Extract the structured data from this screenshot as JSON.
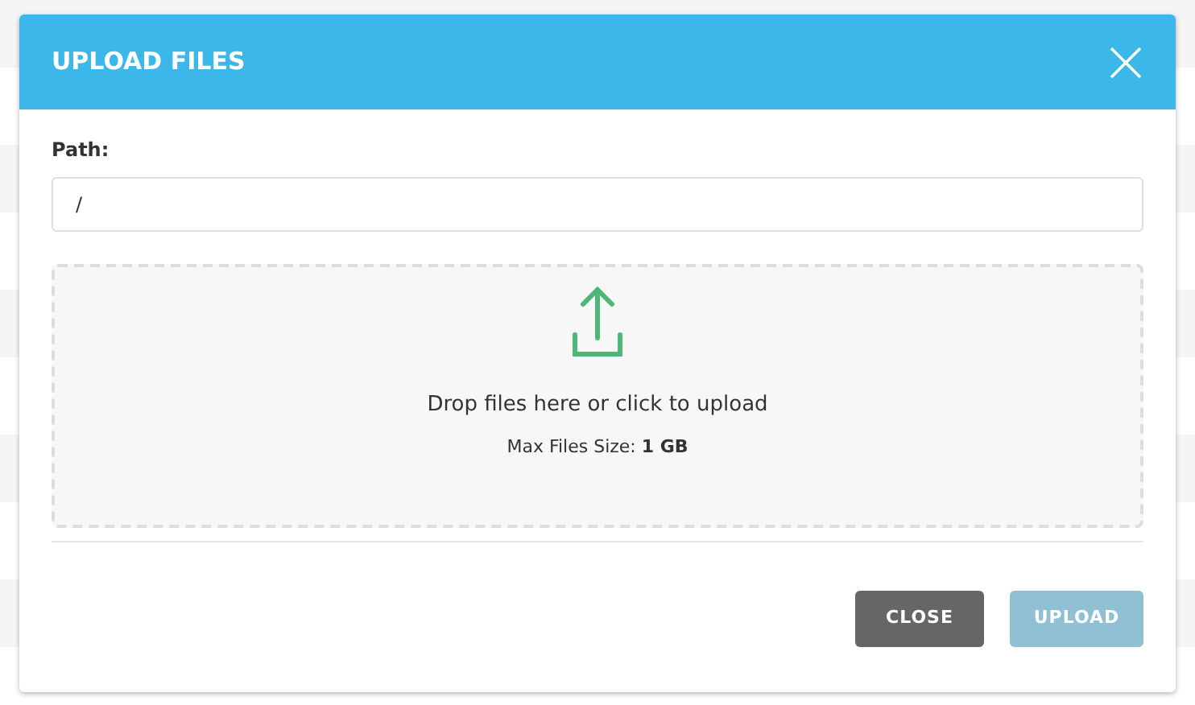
{
  "dialog": {
    "title": "UPLOAD FILES"
  },
  "path": {
    "label": "Path:",
    "value": "/"
  },
  "dropzone": {
    "text": "Drop files here or click to upload",
    "limit": "Max Files Size: **1 GB**"
  },
  "buttons": [
    {
      "label": "CLOSE",
      "kind": "secondary",
      "disabled": false
    },
    {
      "label": "UPLOAD",
      "kind": "primary",
      "disabled": true
    }
  ]
}
